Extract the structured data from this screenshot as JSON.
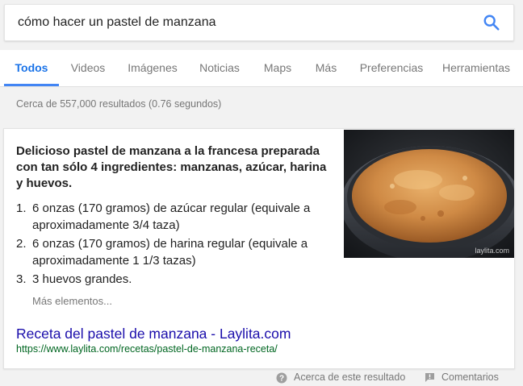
{
  "search": {
    "query": "cómo hacer un pastel de manzana"
  },
  "tabs": [
    {
      "label": "Todos",
      "active": true
    },
    {
      "label": "Videos"
    },
    {
      "label": "Imágenes"
    },
    {
      "label": "Noticias"
    },
    {
      "label": "Maps"
    },
    {
      "label": "Más"
    },
    {
      "label": "Preferencias"
    },
    {
      "label": "Herramientas"
    }
  ],
  "result_stats": "Cerca de 557,000 resultados (0.76 segundos)",
  "featured": {
    "headline": "Delicioso pastel de manzana a la francesa preparada con tan sólo 4 ingredientes: manzanas, azúcar, harina y huevos.",
    "steps": [
      {
        "num": "1.",
        "text": "6 onzas (170 gramos) de azúcar regular (equivale a aproximadamente 3/4 taza)"
      },
      {
        "num": "2.",
        "text": "6 onzas (170 gramos) de harina regular (equivale a aproximadamente 1 1/3 tazas)"
      },
      {
        "num": "3.",
        "text": "3 huevos grandes."
      }
    ],
    "more": "Más elementos...",
    "title": "Receta del pastel de manzana - Laylita.com",
    "url": "https://www.laylita.com/recetas/pastel-de-manzana-receta/",
    "image_caption": "laylita.com"
  },
  "footer": {
    "about": "Acerca de este resultado",
    "feedback": "Comentarios"
  },
  "colors": {
    "accent": "#4285f4",
    "link": "#1a0dab",
    "url": "#006621"
  }
}
